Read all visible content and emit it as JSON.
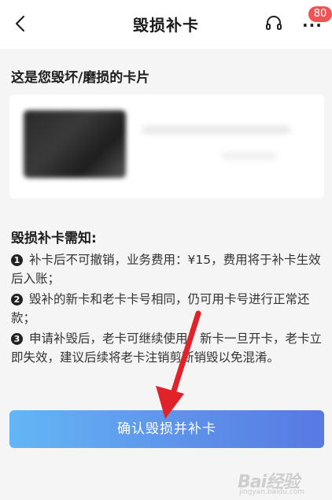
{
  "header": {
    "title": "毁损补卡",
    "badge_count": "80"
  },
  "card_section": {
    "title": "这是您毁坏/磨损的卡片"
  },
  "notice": {
    "title": "毁损补卡需知:",
    "items": [
      {
        "num": "1",
        "text": "补卡后不可撤销，业务费用：¥15，费用将于补卡生效后入账；"
      },
      {
        "num": "2",
        "text": "毁补的新卡和老卡卡号相同，仍可用卡号进行正常还款；"
      },
      {
        "num": "3",
        "text": "申请补毁后，老卡可继续使用，新卡一旦开卡，老卡立即失效，建议后续将老卡注销剪断销毁以免混淆。"
      }
    ]
  },
  "actions": {
    "confirm_label": "确认毁损并补卡"
  },
  "watermark": {
    "logo": "Bai经验",
    "sub": "jingyan.baidu.com"
  },
  "colors": {
    "badge": "#ef5454",
    "button_start": "#63b6f5",
    "button_end": "#5779e2",
    "arrow": "#e0222a"
  },
  "icons": {
    "back": "chevron-left-icon",
    "service": "headset-icon",
    "more": "more-dots-icon"
  }
}
